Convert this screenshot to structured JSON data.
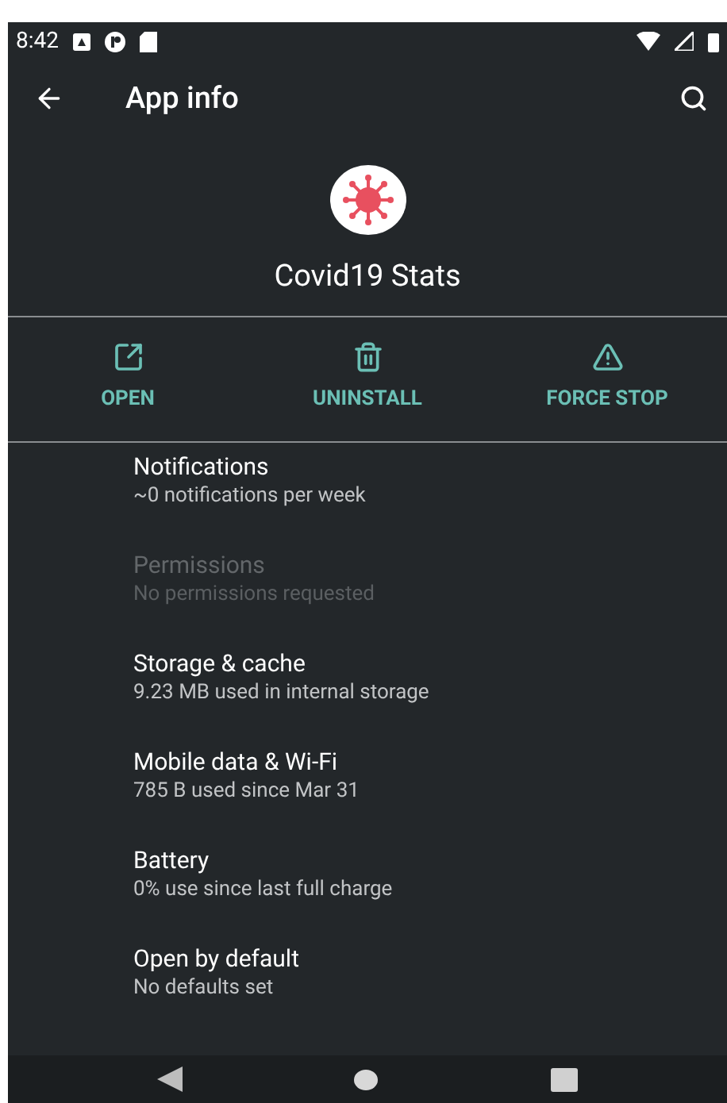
{
  "status_bar": {
    "time": "8:42"
  },
  "app_bar": {
    "title": "App info"
  },
  "app": {
    "name": "Covid19 Stats"
  },
  "actions": [
    {
      "label": "OPEN",
      "kind": "open"
    },
    {
      "label": "UNINSTALL",
      "kind": "uninstall"
    },
    {
      "label": "FORCE STOP",
      "kind": "stop"
    }
  ],
  "settings": [
    {
      "title": "Notifications",
      "summary": "~0 notifications per week",
      "disabled": false
    },
    {
      "title": "Permissions",
      "summary": "No permissions requested",
      "disabled": true
    },
    {
      "title": "Storage & cache",
      "summary": "9.23 MB used in internal storage",
      "disabled": false
    },
    {
      "title": "Mobile data & Wi-Fi",
      "summary": "785 B used since Mar 31",
      "disabled": false
    },
    {
      "title": "Battery",
      "summary": "0% use since last full charge",
      "disabled": false
    },
    {
      "title": "Open by default",
      "summary": "No defaults set",
      "disabled": false
    }
  ]
}
